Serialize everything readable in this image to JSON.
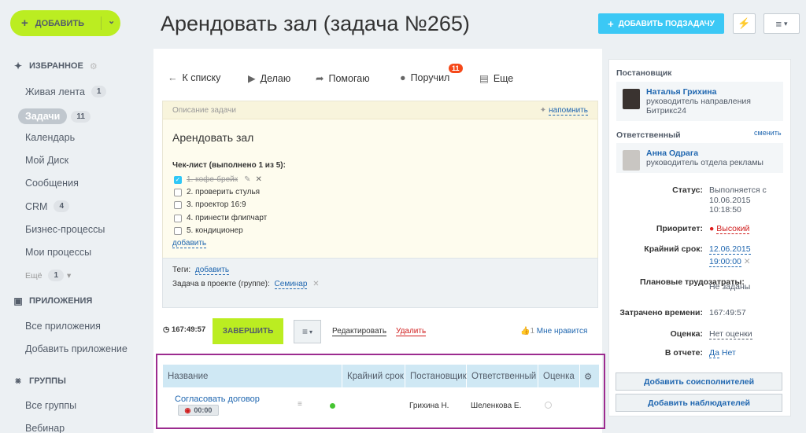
{
  "sidebar": {
    "add_label": "ДОБАВИТЬ",
    "favorites_label": "ИЗБРАННОЕ",
    "items": [
      {
        "label": "Живая лента",
        "count": "1"
      },
      {
        "label": "Задачи",
        "count": "11"
      },
      {
        "label": "Календарь"
      },
      {
        "label": "Мой Диск"
      },
      {
        "label": "Сообщения"
      },
      {
        "label": "CRM",
        "count": "4"
      },
      {
        "label": "Бизнес-процессы"
      },
      {
        "label": "Мои процессы"
      }
    ],
    "more_label": "Ещё",
    "more_count": "1",
    "apps_label": "ПРИЛОЖЕНИЯ",
    "apps_items": [
      "Все приложения",
      "Добавить приложение"
    ],
    "groups_label": "ГРУППЫ",
    "groups_items": [
      "Все группы",
      "Вебинар"
    ]
  },
  "header": {
    "title": "Арендовать зал (задача №265)",
    "add_subtask": "ДОБАВИТЬ ПОДЗАДАЧУ"
  },
  "toolbar": {
    "back": "К списку",
    "doing": "Делаю",
    "help": "Помогаю",
    "assigned": "Поручил",
    "assigned_badge": "11",
    "more": "Еще"
  },
  "description": {
    "head": "Описание задачи",
    "remind": "напомнить",
    "task_name": "Арендовать зал",
    "checklist_title": "Чек-лист (выполнено 1 из 5):",
    "checklist": [
      {
        "text": "1. кофе-брейк",
        "done": true
      },
      {
        "text": "2. проверить стулья",
        "done": false
      },
      {
        "text": "3. проектор 16:9",
        "done": false
      },
      {
        "text": "4. принести флипчарт",
        "done": false
      },
      {
        "text": "5. кондиционер",
        "done": false
      }
    ],
    "add": "добавить"
  },
  "tags": {
    "label": "Теги:",
    "add": "добавить",
    "project_label": "Задача в проекте (группе):",
    "project": "Семинар"
  },
  "actions": {
    "timer": "167:49:57",
    "finish": "ЗАВЕРШИТЬ",
    "edit": "Редактировать",
    "delete": "Удалить",
    "likes": "1",
    "like_label": "Мне нравится"
  },
  "subtasks": {
    "columns": [
      "Название",
      "Крайний срок",
      "Постановщик",
      "Ответственный",
      "Оценка"
    ],
    "rows": [
      {
        "name": "Согласовать договор",
        "time": "00:00",
        "creator": "Грихина Н.",
        "responsible": "Шеленкова Е."
      }
    ]
  },
  "right": {
    "creator_label": "Постановщик",
    "creator_name": "Наталья Грихина",
    "creator_pos": "руководитель направления Битрикс24",
    "resp_label": "Ответственный",
    "resp_change": "сменить",
    "resp_name": "Анна Одрага",
    "resp_pos": "руководитель отдела рекламы",
    "status_k": "Статус:",
    "status_v": "Выполняется с 10.06.2015 10:18:50",
    "priority_k": "Приоритет:",
    "priority_v": "Высокий",
    "deadline_k": "Крайний срок:",
    "deadline_date": "12.06.2015",
    "deadline_time": "19:00:00",
    "plan_k": "Плановые трудозатраты:",
    "plan_v": "Не заданы",
    "spent_k": "Затрачено времени:",
    "spent_v": "167:49:57",
    "mark_k": "Оценка:",
    "mark_v": "Нет оценки",
    "report_k": "В отчете:",
    "report_yes": "Да",
    "report_no": "Нет",
    "add_coexec": "Добавить соисполнителей",
    "add_observers": "Добавить наблюдателей"
  }
}
